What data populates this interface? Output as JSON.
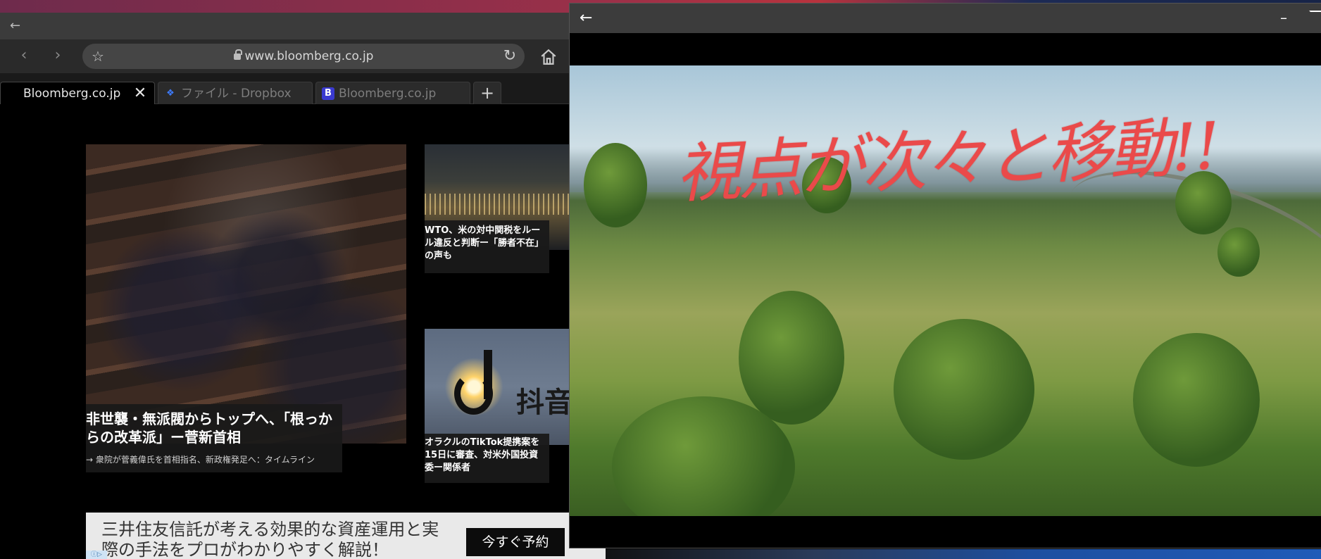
{
  "browser": {
    "url": "www.bloomberg.co.jp",
    "tabs": [
      {
        "label": "Bloomberg.co.jp",
        "active": true,
        "icon": "none"
      },
      {
        "label": "ファイル - Dropbox",
        "active": false,
        "icon": "dropbox-icon"
      },
      {
        "label": "Bloomberg.co.jp",
        "active": false,
        "icon": "bloomberg-icon"
      }
    ],
    "new_tab_label": "+",
    "close_glyph": "✕"
  },
  "news": {
    "main_headline": "非世襲・無派閥からトップへ、「根っからの改革派」ー菅新首相",
    "main_sub": "→ 衆院が菅義偉氏を首相指名、新政権発足へ：タイムライン",
    "side1_headline": "WTO、米の対中関税をルール違反と判断ー「勝者不在」の声も",
    "side2_headline": "オラクルのTikTok提携案を15日に審査、対米外国投資委ー関係者",
    "side2_sign_text": "抖音"
  },
  "ad": {
    "text": "三井住友信託が考える効果的な資産運用と実際の手法をプロがわかりやすく解説！",
    "button": "今すぐ予約"
  },
  "video": {
    "overlay_text": "視点が次々と移動!!"
  },
  "colors": {
    "overlay_red": "#ea4a4a",
    "toolbar": "#2a2a2a",
    "titlebar": "#3b3b3b"
  }
}
